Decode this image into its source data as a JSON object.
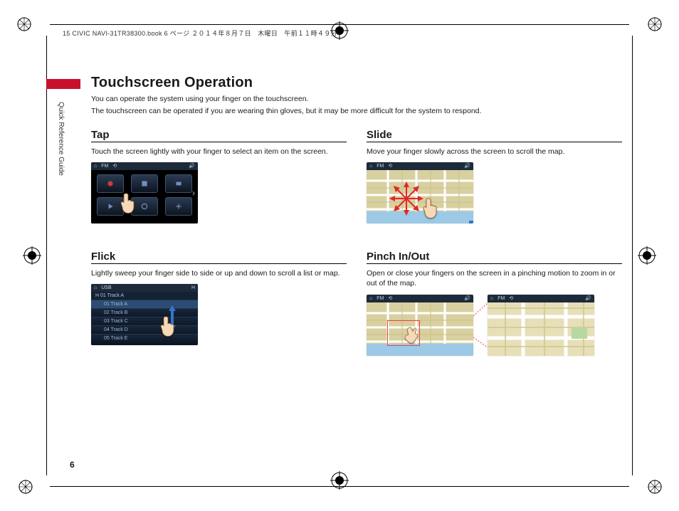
{
  "slug": "15 CIVIC NAVI-31TR38300.book  6 ページ  ２０１４年８月７日　木曜日　午前１１時４９分",
  "side_label": "Quick Reference Guide",
  "page_number": "6",
  "title": "Touchscreen Operation",
  "intro_line1": "You can operate the system using your finger on the touchscreen.",
  "intro_line2": "The touchscreen can be operated if you are wearing thin gloves, but it may be more difficult for the system to respond.",
  "sections": {
    "tap": {
      "heading": "Tap",
      "desc": "Touch the screen lightly with your finger to select an item on the screen.",
      "bar_items": [
        "⌂",
        "FM",
        "⟲",
        "🔊"
      ],
      "tracks": [
        "01 Track A",
        "02 Track B",
        "03 Track C",
        "04 Track D",
        "05 Track E"
      ]
    },
    "flick": {
      "heading": "Flick",
      "desc": "Lightly sweep your finger side to side or up and down to scroll a list or map.",
      "bar_items": [
        "⌂",
        "USB",
        "H"
      ],
      "list_header": "H  01 Track A"
    },
    "slide": {
      "heading": "Slide",
      "desc": "Move your finger slowly across the screen to scroll the map.",
      "bar_items": [
        "⌂",
        "FM",
        "⟲",
        "🔊"
      ]
    },
    "pinch": {
      "heading": "Pinch In/Out",
      "desc": "Open or close your fingers on the screen in a pinching motion to zoom in or out of the map.",
      "bar_items": [
        "⌂",
        "FM",
        "⟲",
        "🔊"
      ]
    }
  }
}
